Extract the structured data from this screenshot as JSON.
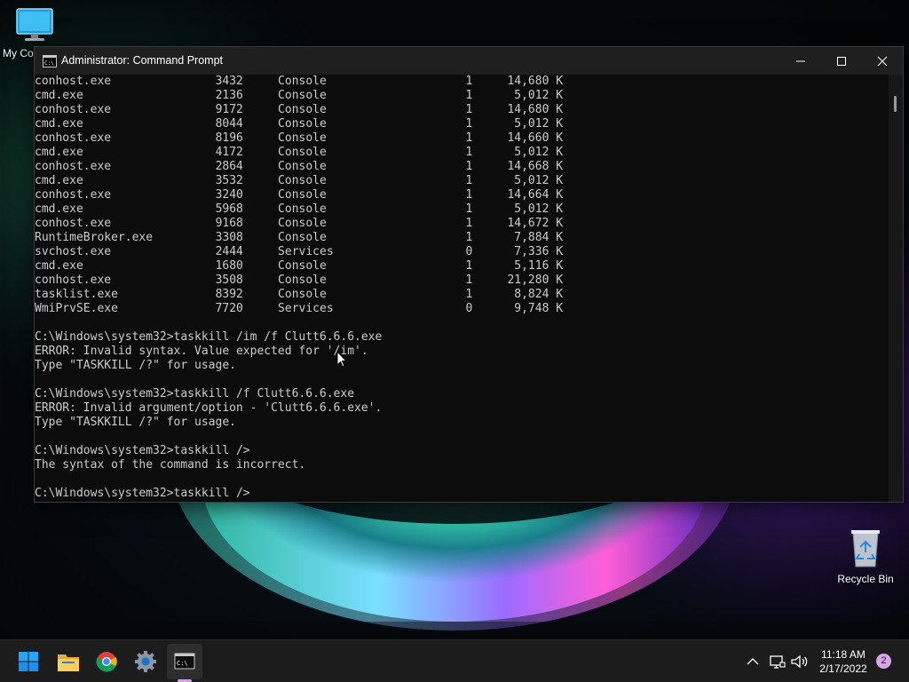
{
  "desktop": {
    "icons": {
      "my_computer": "My Computer",
      "recycle_bin": "Recycle Bin"
    }
  },
  "window": {
    "title": "Administrator: Command Prompt",
    "controls": [
      "minimize",
      "maximize",
      "close"
    ]
  },
  "console": {
    "tasklist_rows": [
      {
        "image": "conhost.exe",
        "pid": "3432",
        "session": "Console",
        "session_num": "1",
        "mem": "14,680 K"
      },
      {
        "image": "cmd.exe",
        "pid": "2136",
        "session": "Console",
        "session_num": "1",
        "mem": "5,012 K"
      },
      {
        "image": "conhost.exe",
        "pid": "9172",
        "session": "Console",
        "session_num": "1",
        "mem": "14,680 K"
      },
      {
        "image": "cmd.exe",
        "pid": "8044",
        "session": "Console",
        "session_num": "1",
        "mem": "5,012 K"
      },
      {
        "image": "conhost.exe",
        "pid": "8196",
        "session": "Console",
        "session_num": "1",
        "mem": "14,660 K"
      },
      {
        "image": "cmd.exe",
        "pid": "4172",
        "session": "Console",
        "session_num": "1",
        "mem": "5,012 K"
      },
      {
        "image": "conhost.exe",
        "pid": "2864",
        "session": "Console",
        "session_num": "1",
        "mem": "14,668 K"
      },
      {
        "image": "cmd.exe",
        "pid": "3532",
        "session": "Console",
        "session_num": "1",
        "mem": "5,012 K"
      },
      {
        "image": "conhost.exe",
        "pid": "3240",
        "session": "Console",
        "session_num": "1",
        "mem": "14,664 K"
      },
      {
        "image": "cmd.exe",
        "pid": "5968",
        "session": "Console",
        "session_num": "1",
        "mem": "5,012 K"
      },
      {
        "image": "conhost.exe",
        "pid": "9168",
        "session": "Console",
        "session_num": "1",
        "mem": "14,672 K"
      },
      {
        "image": "RuntimeBroker.exe",
        "pid": "3308",
        "session": "Console",
        "session_num": "1",
        "mem": "7,884 K"
      },
      {
        "image": "svchost.exe",
        "pid": "2444",
        "session": "Services",
        "session_num": "0",
        "mem": "7,336 K"
      },
      {
        "image": "cmd.exe",
        "pid": "1680",
        "session": "Console",
        "session_num": "1",
        "mem": "5,116 K"
      },
      {
        "image": "conhost.exe",
        "pid": "3508",
        "session": "Console",
        "session_num": "1",
        "mem": "21,280 K"
      },
      {
        "image": "tasklist.exe",
        "pid": "8392",
        "session": "Console",
        "session_num": "1",
        "mem": "8,824 K"
      },
      {
        "image": "WmiPrvSE.exe",
        "pid": "7720",
        "session": "Services",
        "session_num": "0",
        "mem": "9,748 K"
      }
    ],
    "output_lines": [
      "",
      "C:\\Windows\\system32>taskkill /im /f Clutt6.6.6.exe",
      "ERROR: Invalid syntax. Value expected for '/im'.",
      "Type \"TASKKILL /?\" for usage.",
      "",
      "C:\\Windows\\system32>taskkill /f Clutt6.6.6.exe",
      "ERROR: Invalid argument/option - 'Clutt6.6.6.exe'.",
      "Type \"TASKKILL /?\" for usage.",
      "",
      "C:\\Windows\\system32>taskkill />",
      "The syntax of the command is incorrect.",
      "",
      "C:\\Windows\\system32>taskkill />"
    ]
  },
  "taskbar": {
    "apps": [
      "start-menu",
      "file-explorer",
      "chrome",
      "settings",
      "command-prompt"
    ],
    "clock": {
      "time": "11:18 AM",
      "date": "2/17/2022"
    },
    "notification_count": "2"
  },
  "colors": {
    "console_bg": "#0c0c0c",
    "console_text": "#cccccc",
    "titlebar_bg": "#1f1f1f",
    "taskbar_bg": "#1c1c1c"
  }
}
